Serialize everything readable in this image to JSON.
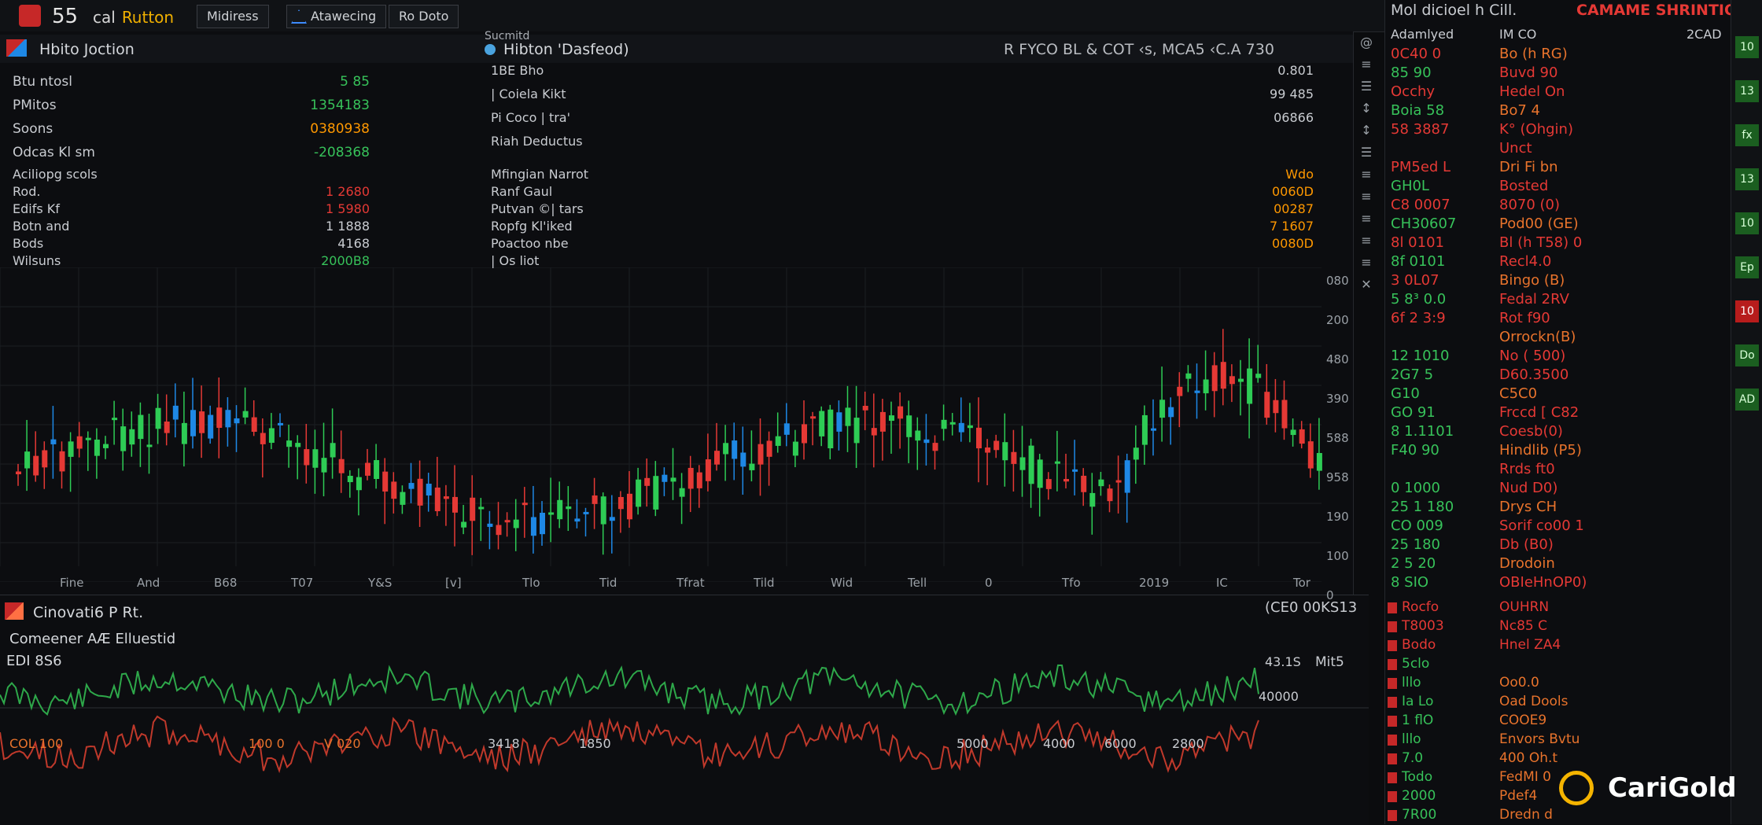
{
  "topbar": {
    "num": "55",
    "brand": "cal",
    "brand_accent": "Rutton",
    "tabs": [
      "Midiress",
      "Atawecing",
      "Ro Doto"
    ]
  },
  "panel": {
    "title_left": "Hbito Joction",
    "title_mid_small": "Sucmitd",
    "title_mid": "Hibton 'Dasfeod)",
    "title_right": "R FYCO BL & COT ‹s, MCA5 ‹C.A 730",
    "stats_left": [
      {
        "label": "Btu ntosl",
        "value": "5 85",
        "color": "g"
      },
      {
        "label": "PMitos",
        "value": "1354183",
        "color": "g"
      },
      {
        "label": "Soons",
        "value": "0380938",
        "color": "o"
      },
      {
        "label": "Odcas Kl sm",
        "value": "-208368",
        "color": "g"
      }
    ],
    "stats_left2": [
      {
        "label": "Aciliopg scols",
        "value": "",
        "color": "w"
      },
      {
        "label": "Rod.",
        "value": "1 2680",
        "color": "r"
      },
      {
        "label": "Edifs Kf",
        "value": "1 5980",
        "color": "r"
      },
      {
        "label": "Botn and",
        "value": "1 1888",
        "color": "w"
      },
      {
        "label": "Bods",
        "value": "4168",
        "color": "w"
      },
      {
        "label": "Wilsuns",
        "value": "2000B8",
        "color": "g"
      }
    ],
    "stats_mid": [
      {
        "label": "1BE   Bho",
        "value": "0.801"
      },
      {
        "label": "| Coiela Kikt",
        "value": "99 485"
      },
      {
        "label": "Pi Coco  | tra'",
        "value": "06866"
      },
      {
        "label": "Riah  Deductus",
        "value": ""
      }
    ],
    "stats_mid2": [
      {
        "label": "Mfingian Narrot",
        "value": "Wdo"
      },
      {
        "label": "Ranf Gaul",
        "value": "0060D"
      },
      {
        "label": "Putvan ©| tars",
        "value": "00287"
      },
      {
        "label": "Ropfg Kl'iked",
        "value": "7 1607"
      },
      {
        "label": "Poactoo nbe",
        "value": "0080D"
      },
      {
        "label": "| Os liot",
        "value": ""
      }
    ]
  },
  "chart_axis": {
    "y_labels": [
      "080",
      "200",
      "480",
      "390",
      "588",
      "958",
      "190",
      "100",
      "0"
    ],
    "x_labels": [
      "Fine",
      "And",
      "B68",
      "T07",
      "Y&S",
      "[v]",
      "Tlo",
      "Tid",
      "Tfrat",
      "Tild",
      "Wid",
      "Tell",
      "0",
      "Tfo",
      "2019",
      "IC",
      "Tor"
    ]
  },
  "tools": [
    "@",
    "≡",
    "☰",
    "↕",
    "↕",
    "☰",
    "≡",
    "≡",
    "≡",
    "≡",
    "≡",
    "✕"
  ],
  "rightlist": {
    "header_left": "Mol dicioel  h Cill.",
    "header_right": "CAMAME SHRINTION:",
    "subhead_a": "Adamlyed",
    "subhead_b": "IM CO",
    "subhead_c": "2CAD",
    "rows": [
      {
        "code": "0C40 0",
        "name": "Bo (h RG)"
      },
      {
        "code": "85  90",
        "name": "Buvd 90"
      },
      {
        "code": "Occhy",
        "name": "Hedel On"
      },
      {
        "code": "Boia 58",
        "name": "Bo7 4"
      },
      {
        "code": "58 3887",
        "name": "K° (Ohgin)"
      },
      {
        "code": "",
        "name": "Unct"
      },
      {
        "code": "PM5ed L",
        "name": "Dri Fi bn"
      },
      {
        "code": "GH0L",
        "name": "Bosted"
      },
      {
        "code": "C8 0007",
        "name": "8070 (0)"
      },
      {
        "code": "CH30607",
        "name": "Pod00 (GE)"
      },
      {
        "code": "8l 0101",
        "name": "Bl (h T58) 0"
      },
      {
        "code": "8f 0101",
        "name": "Recl4.0"
      },
      {
        "code": "3 0L07",
        "name": "Bingo (B)"
      },
      {
        "code": "5 8³ 0.0",
        "name": "Fedal  2RV"
      },
      {
        "code": "6f 2 3:9",
        "name": "Rot f90"
      },
      {
        "code": "",
        "name": "Orrockn(B)"
      },
      {
        "code": "12 1010",
        "name": "No ( 500)"
      },
      {
        "code": "2G7 5",
        "name": "D60.3500"
      },
      {
        "code": "G10",
        "name": "C5C0"
      },
      {
        "code": "GO 91",
        "name": "Frccd [ C82"
      },
      {
        "code": "8 1.1101",
        "name": "Coesb(0)"
      },
      {
        "code": "F40 90",
        "name": "Hindlib (P5)"
      },
      {
        "code": "",
        "name": "Rrds ft0"
      },
      {
        "code": "0 1000",
        "name": "Nud D0)"
      },
      {
        "code": "25 1 180",
        "name": "Drys CH"
      },
      {
        "code": "CO 009",
        "name": "Sorif co00 1"
      },
      {
        "code": "25 180",
        "name": "Db (B0)"
      },
      {
        "code": "2 5 20",
        "name": "Drodoin"
      },
      {
        "code": "8 SIO",
        "name": "OBIeHnOP0)"
      }
    ],
    "rows2": [
      {
        "code": "Rocfo",
        "name": "OUHRN"
      },
      {
        "code": "T8003",
        "name": "Nc85 C"
      },
      {
        "code": "Bodo",
        "name": "Hnel ZA4"
      },
      {
        "code": "5clo",
        "name": ""
      },
      {
        "code": "lllo",
        "name": "Oo0.0"
      },
      {
        "code": "Ia Lo",
        "name": "Oad Dools"
      },
      {
        "code": "1 flO",
        "name": "COOE9"
      },
      {
        "code": "lllo",
        "name": "Envors Bvtu"
      },
      {
        "code": "7.0",
        "name": "400 Oh.t"
      },
      {
        "code": "Todo",
        "name": "FedMI 0"
      },
      {
        "code": "2000",
        "name": "Pdef4"
      },
      {
        "code": "7R00",
        "name": "Dredn d"
      }
    ]
  },
  "strip": [
    "10",
    "13",
    "fx",
    "13",
    "10",
    "Ep",
    "10",
    "Do",
    "AD"
  ],
  "bottom": {
    "title": "Cinovati6 P Rt.",
    "subtitle": "Comeener AÆ Elluestid",
    "header_right": "(CE0 00KS13",
    "legend": "EDI 8S6",
    "label_top_right1": "43.1S",
    "label_top_right2": "Mit5",
    "label_top_right3": "40000",
    "labels": [
      "COL 100",
      "100 0",
      "V 020",
      "3418",
      "1850",
      "5000",
      "4000",
      "6000",
      "2800"
    ]
  },
  "watermark": {
    "text": "CariGold"
  },
  "colors": {
    "up": "#2ecc55",
    "down": "#e53935",
    "blue": "#1e88e5",
    "bg": "#0b0c0e",
    "line_g": "#2ea84a",
    "line_r": "#c0392b"
  }
}
